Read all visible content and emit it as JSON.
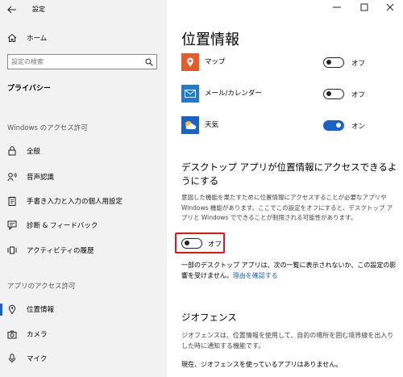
{
  "window": {
    "title": "設定"
  },
  "sidebar": {
    "home_label": "ホーム",
    "search_placeholder": "設定の検索",
    "category": "プライバシー",
    "windows_section": "Windows のアクセス許可",
    "windows_items": [
      {
        "label": "全般",
        "icon": "lock-icon"
      },
      {
        "label": "音声認識",
        "icon": "speech-icon"
      },
      {
        "label": "手書き入力と入力の個人用設定",
        "icon": "notepad-icon"
      },
      {
        "label": "診断 & フィードバック",
        "icon": "feedback-icon"
      },
      {
        "label": "アクティビティの履歴",
        "icon": "history-icon"
      }
    ],
    "app_section": "アプリのアクセス許可",
    "app_items": [
      {
        "label": "位置情報",
        "icon": "location-icon",
        "selected": true
      },
      {
        "label": "カメラ",
        "icon": "camera-icon"
      },
      {
        "label": "マイク",
        "icon": "microphone-icon"
      }
    ]
  },
  "main": {
    "title": "位置情報",
    "apps": [
      {
        "name": "マップ",
        "state": "オフ",
        "on": false,
        "color": "#e85c2c",
        "icon": "maps-icon"
      },
      {
        "name": "メール/カレンダー",
        "state": "オフ",
        "on": false,
        "color": "#1f7ad4",
        "icon": "mail-icon"
      },
      {
        "name": "天気",
        "state": "オン",
        "on": true,
        "color": "#1a63c4",
        "icon": "weather-icon"
      }
    ],
    "desktop_heading": "デスクトップ アプリが位置情報にアクセスできるようにする",
    "desktop_desc": "意図した機能を果たすために位置情報にアクセスすることが必要なアプリや Windows 機能があります。ここでこの設定をオフにすると、デスクトップ アプリと Windows でできることが制限される可能性があります。",
    "desktop_toggle_state": "オフ",
    "desktop_note": "一部のデスクトップ アプリは、次の一覧に表示されないか、この設定の影響を受けません。",
    "desktop_link": "理由を確認する",
    "geofence_heading": "ジオフェンス",
    "geofence_desc": "ジオフェンスは、位置情報を使用して、自的の場所を囲む境界線を出入りした時に通知する機能です。",
    "geofence_status": "現在、ジオフェンスを使っているアプリはありません。"
  },
  "colors": {
    "accent": "#1a63c4",
    "highlight": "#e8131b",
    "link": "#1a63c4"
  }
}
